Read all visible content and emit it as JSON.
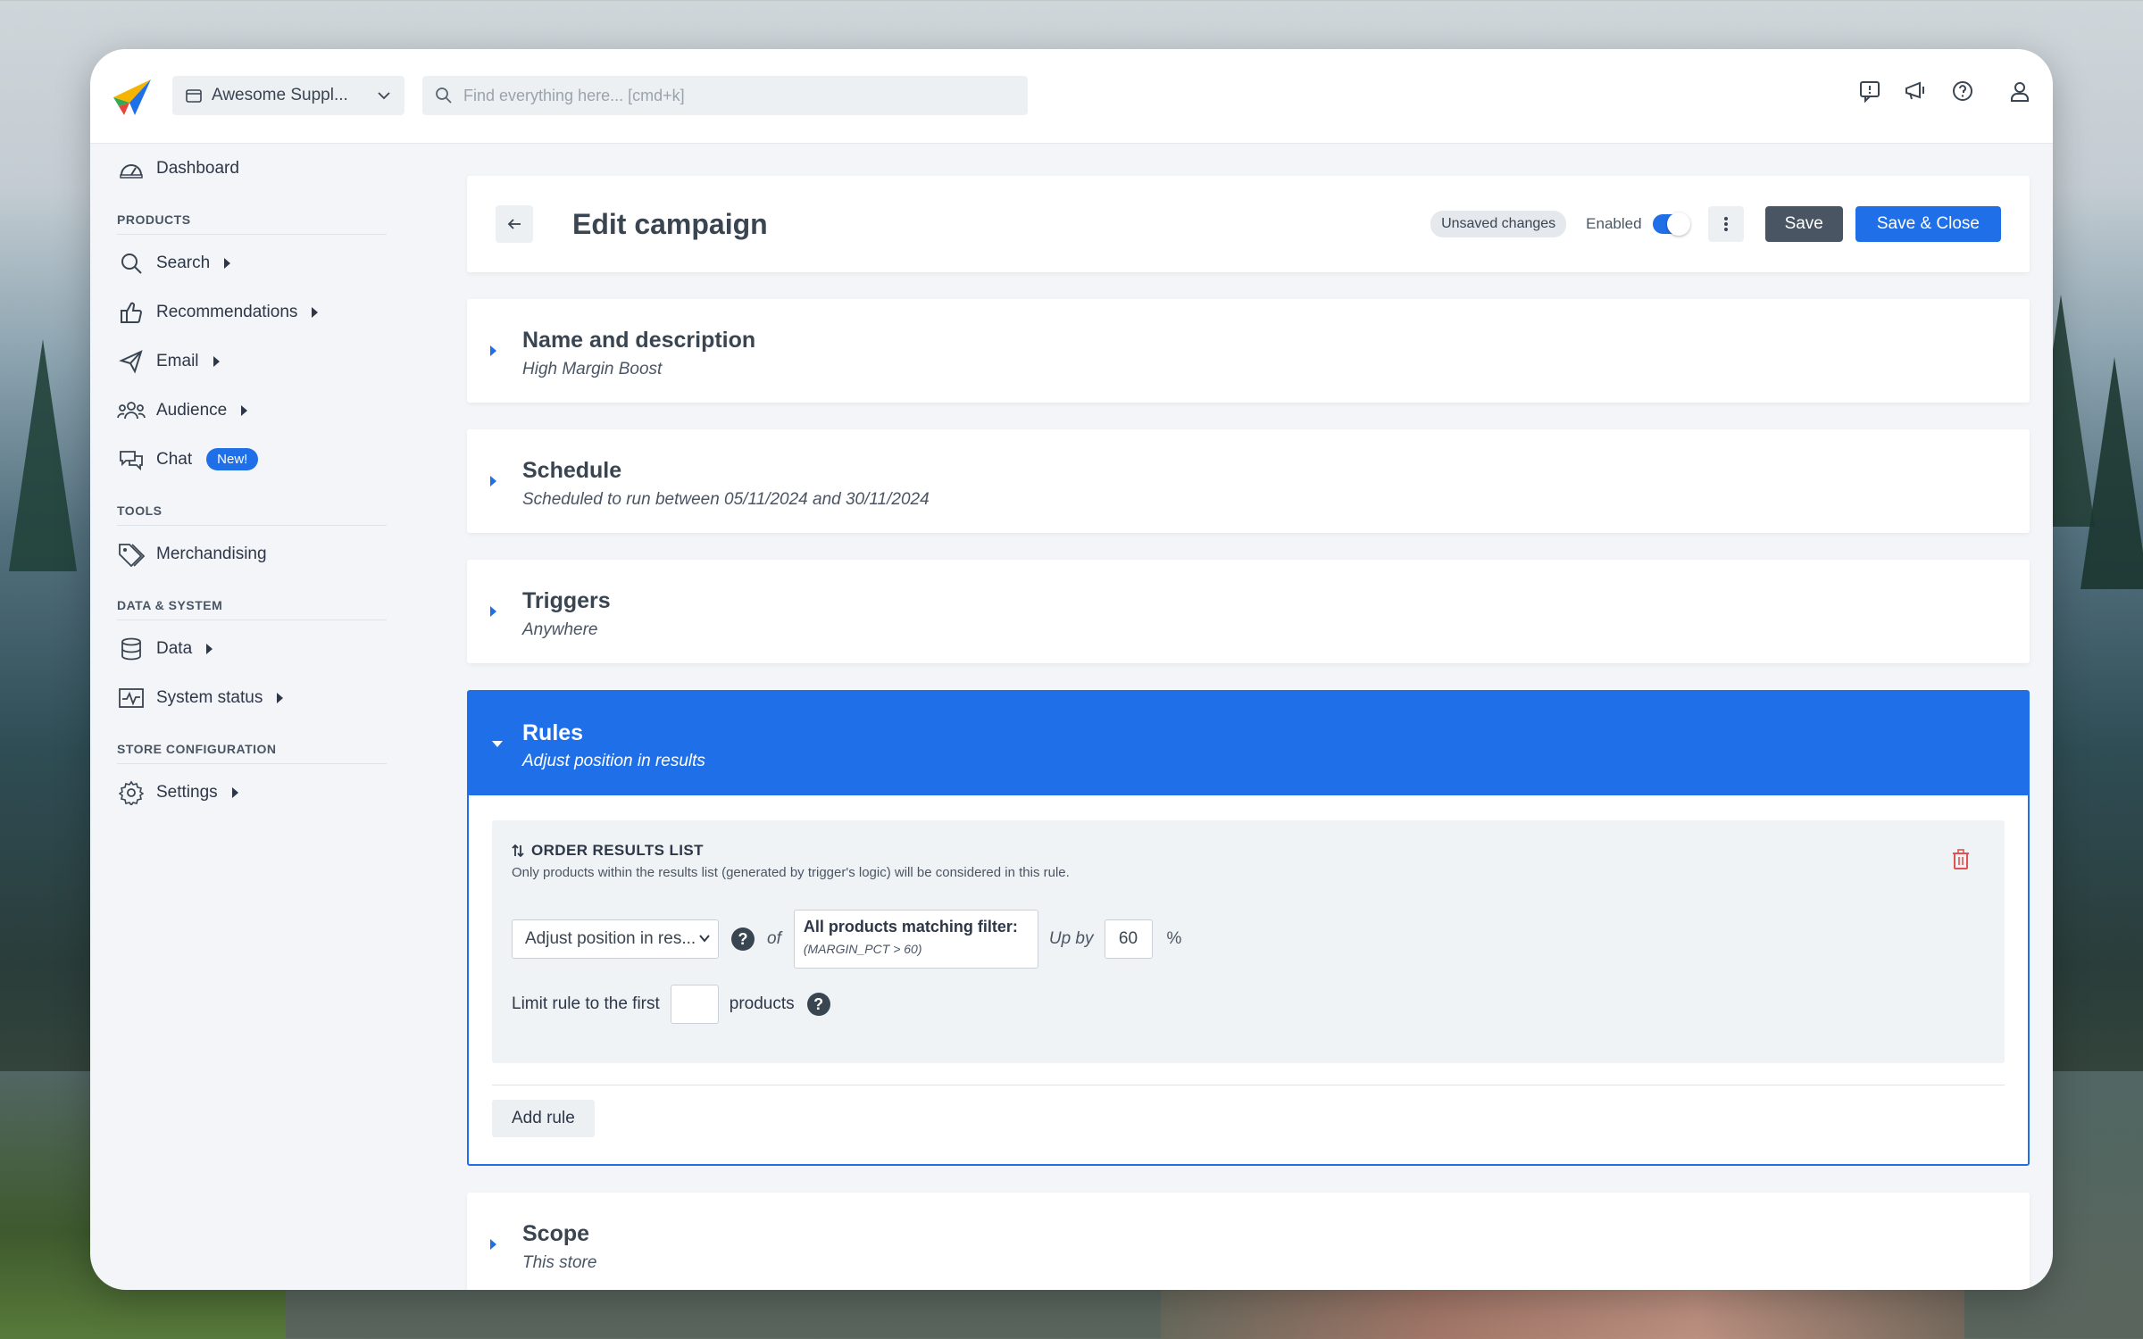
{
  "topbar": {
    "store_name": "Awesome Suppl...",
    "search_placeholder": "Find everything here... [cmd+k]"
  },
  "sidebar": {
    "dashboard": "Dashboard",
    "products_label": "PRODUCTS",
    "search": "Search",
    "recommendations": "Recommendations",
    "email": "Email",
    "audience": "Audience",
    "chat": "Chat",
    "chat_badge": "New!",
    "tools_label": "TOOLS",
    "merchandising": "Merchandising",
    "data_system_label": "DATA & SYSTEM",
    "data": "Data",
    "system_status": "System status",
    "store_config_label": "STORE CONFIGURATION",
    "settings": "Settings"
  },
  "header": {
    "title": "Edit campaign",
    "unsaved": "Unsaved changes",
    "enabled_label": "Enabled",
    "enabled": true,
    "save": "Save",
    "save_close": "Save & Close"
  },
  "sections": {
    "name": {
      "title": "Name and description",
      "subtitle": "High Margin Boost"
    },
    "schedule": {
      "title": "Schedule",
      "subtitle": "Scheduled to run between 05/11/2024 and 30/11/2024"
    },
    "triggers": {
      "title": "Triggers",
      "subtitle": "Anywhere"
    },
    "rules": {
      "title": "Rules",
      "subtitle": "Adjust position in results"
    },
    "scope": {
      "title": "Scope",
      "subtitle": "This store"
    }
  },
  "rule": {
    "heading": "ORDER RESULTS LIST",
    "description": "Only products within the results list (generated by trigger's logic) will be considered in this rule.",
    "action_value": "Adjust position in res...",
    "of": "of",
    "filter_title": "All products matching filter:",
    "filter_expr": "(MARGIN_PCT > 60)",
    "up_by": "Up by",
    "amount": "60",
    "percent": "%",
    "limit_prefix": "Limit rule to the first",
    "limit_suffix": "products",
    "help_glyph": "?"
  },
  "add_rule": "Add rule",
  "colors": {
    "accent": "#1f6fe8",
    "dark_button": "#4a5564",
    "danger": "#e05252"
  }
}
